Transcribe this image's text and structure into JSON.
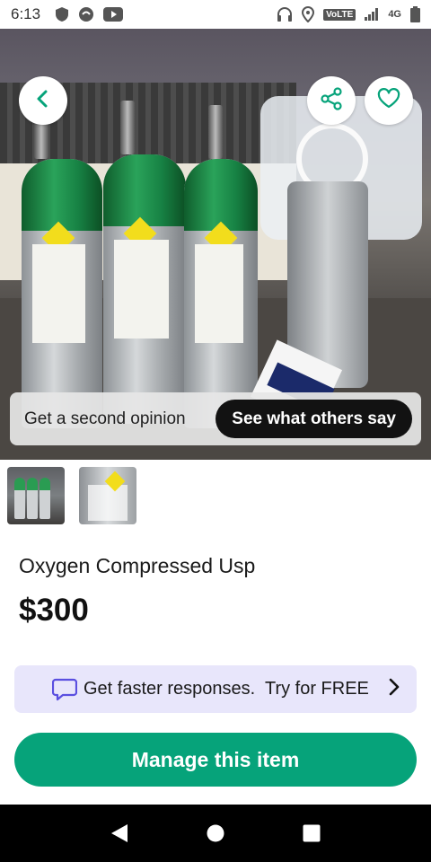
{
  "status_bar": {
    "time": "6:13",
    "volte": "VoLTE",
    "network": "4G"
  },
  "hero": {
    "back_icon": "chevron-left-icon",
    "share_icon": "share-icon",
    "favorite_icon": "heart-outline-icon",
    "opinion_text": "Get a second opinion",
    "opinion_button": "See what others say"
  },
  "thumbnails": [
    {
      "name": "photo-1"
    },
    {
      "name": "photo-2"
    }
  ],
  "item": {
    "title": "Oxygen Compressed Usp",
    "price": "$300"
  },
  "promo": {
    "text": "Get faster responses.",
    "cta": "Try for FREE",
    "accent": "#e8e6fb",
    "icon_color": "#5a4fe0"
  },
  "actions": {
    "manage_label": "Manage this item",
    "manage_color": "#06a37a"
  }
}
